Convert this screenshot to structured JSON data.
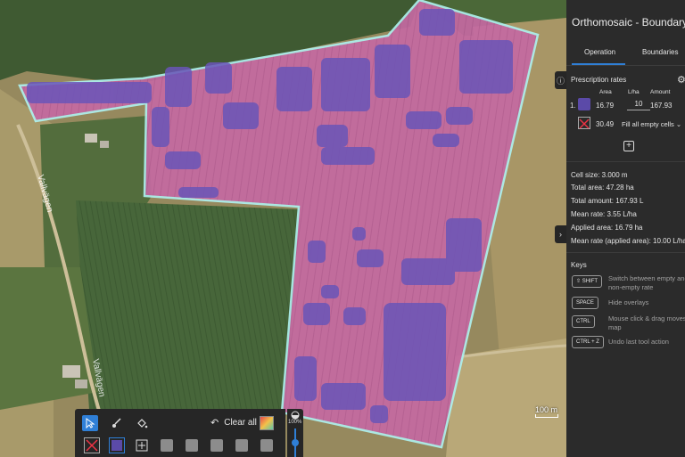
{
  "panel": {
    "title": "Orthomosaic - Boundary Ope",
    "tabs": [
      {
        "label": "Operation",
        "active": true
      },
      {
        "label": "Boundaries",
        "active": false
      }
    ],
    "prescription": {
      "title": "Prescription rates",
      "headers": {
        "area": "Area",
        "rate": "L/ha",
        "amount": "Amount"
      },
      "rows": [
        {
          "index": "1.",
          "color": "#5b4aa8",
          "area": "16.79",
          "rate": "10",
          "amount": "167.93"
        }
      ],
      "empty_row": {
        "area": "30.49",
        "fill_label": "Fill all empty cells"
      }
    },
    "stats": {
      "cell_size": "Cell size:  3.000  m",
      "total_area": "Total area: 47.28 ha",
      "total_amount": "Total amount: 167.93 L",
      "mean_rate": "Mean rate:  3.55  L/ha",
      "applied_area": "Applied area: 16.79 ha",
      "mean_rate_applied": "Mean rate (applied area): 10.00 L/ha"
    },
    "keys": {
      "title": "Keys",
      "items": [
        {
          "key": "⇧ SHIFT",
          "desc": "Switch between empty and non-empty rate"
        },
        {
          "key": "SPACE",
          "desc": "Hide overlays"
        },
        {
          "key": "CTRL",
          "desc": "Mouse click & drag moves map"
        },
        {
          "key": "CTRL + Z",
          "desc": "Undo last tool action"
        }
      ]
    }
  },
  "map": {
    "scale_label": "100 m",
    "road_labels": [
      "Vallvägen",
      "Vallvägen"
    ]
  },
  "toolbar": {
    "clear_label": "Clear all",
    "opacity_label": "100%"
  },
  "colors": {
    "accent": "#2f7fd6",
    "rate_purple": "#5b4aa8",
    "overlay_pink": "#e24aa0",
    "boundary": "#aef0ee"
  }
}
